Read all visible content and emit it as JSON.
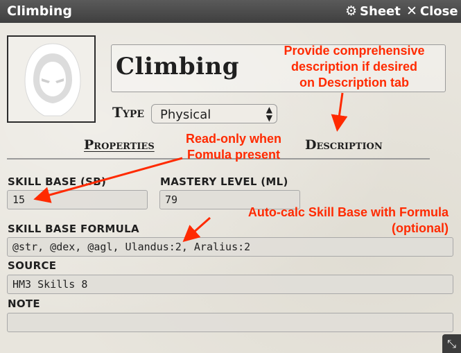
{
  "window": {
    "title": "Climbing",
    "sheet_label": "Sheet",
    "close_label": "Close"
  },
  "item": {
    "name": "Climbing",
    "type_label": "Type",
    "type_value": "Physical"
  },
  "tabs": [
    {
      "label": "Properties",
      "active": true
    },
    {
      "label": "Description",
      "active": false
    }
  ],
  "fields": {
    "skill_base": {
      "label": "SKILL BASE (SB)",
      "value": "15"
    },
    "mastery_level": {
      "label": "MASTERY LEVEL (ML)",
      "value": "79"
    },
    "skill_base_formula": {
      "label": "SKILL BASE FORMULA",
      "value": "@str, @dex, @agl, Ulandus:2, Aralius:2"
    },
    "source": {
      "label": "SOURCE",
      "value": "HM3 Skills 8"
    },
    "note": {
      "label": "NOTE",
      "value": ""
    }
  },
  "annotations": {
    "description_hint": [
      "Provide comprehensive",
      "description if desired",
      "on Description tab"
    ],
    "readonly_hint": [
      "Read-only when",
      "Fomula present"
    ],
    "autocalc_hint": [
      "Auto-calc Skill Base with Formula",
      "(optional)"
    ]
  },
  "colors": {
    "annotation": "#ff2a00",
    "titlebar": "#4a4a4a",
    "background": "#e8e5dd"
  },
  "icons": {
    "sheet": "gear-icon",
    "close": "close-icon",
    "portrait": "hooded-figure-icon",
    "select": "up-down-caret-icon",
    "resize": "resize-icon"
  }
}
